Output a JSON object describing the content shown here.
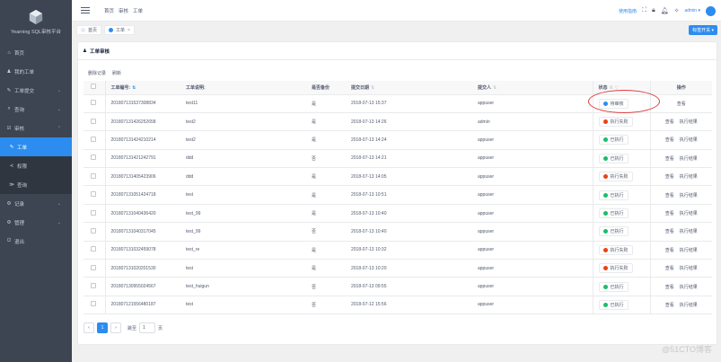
{
  "app": {
    "name": "Yearning SQL审核平台"
  },
  "sidebar": {
    "items": [
      {
        "icon": "home-icon",
        "glyph": "⌂",
        "label": "首页"
      },
      {
        "icon": "user-icon",
        "glyph": "♟",
        "label": "我的工单"
      },
      {
        "icon": "edit-icon",
        "glyph": "✎",
        "label": "工单提交",
        "chevron": "⌄"
      },
      {
        "icon": "search-icon",
        "glyph": "⌕",
        "label": "查询",
        "chevron": "⌄"
      },
      {
        "icon": "audit-icon",
        "glyph": "☑",
        "label": "审核",
        "chevron": "⌃"
      }
    ],
    "audit_sub": [
      {
        "icon": "pencil-icon",
        "glyph": "✎",
        "label": "工单",
        "active": true
      },
      {
        "icon": "share-icon",
        "glyph": "≺",
        "label": "权限"
      },
      {
        "icon": "query-icon",
        "glyph": "≫",
        "label": "查询"
      }
    ],
    "bottom": [
      {
        "icon": "record-icon",
        "glyph": "⚙",
        "label": "记录",
        "chevron": "⌄"
      },
      {
        "icon": "manage-icon",
        "glyph": "⚙",
        "label": "管理",
        "chevron": "⌄"
      },
      {
        "icon": "logout-icon",
        "glyph": "⏻",
        "label": "退出"
      }
    ]
  },
  "header": {
    "breadcrumb": [
      "首页",
      "审核",
      "工单"
    ],
    "help": "使用指南",
    "user": "admin ▾"
  },
  "tabs": {
    "items": [
      {
        "label": "首页",
        "closable": false
      },
      {
        "label": "工单",
        "closable": true,
        "x": "×"
      }
    ],
    "close_btn": "标签开关 ▾"
  },
  "card": {
    "title": "工单审核",
    "actions": [
      "删除记录",
      "刷新"
    ]
  },
  "table": {
    "headers": {
      "id": "工单编号:",
      "desc": "工单说明:",
      "backup": "是否备份",
      "time": "提交日期",
      "submitter": "提交人",
      "status": "状态",
      "op": "操作"
    },
    "sort_desc": "⇅",
    "sort_id": "⇅",
    "filter": "▽",
    "rows": [
      {
        "id": "201807131537308834",
        "desc": "test11",
        "backup": "是",
        "time": "2018-07-13 15:37",
        "submitter": "appuser",
        "status": "待审核",
        "status_color": "#2d8cf0",
        "ops": [
          "查看"
        ]
      },
      {
        "id": "201807131426252658",
        "desc": "test2",
        "backup": "是",
        "time": "2018-07-13 14:26",
        "submitter": "admin",
        "status": "执行失败",
        "status_color": "#ed4014",
        "ops": [
          "查看",
          "执行结果"
        ]
      },
      {
        "id": "201807131424210214",
        "desc": "test2",
        "backup": "是",
        "time": "2018-07-13 14:24",
        "submitter": "appuser",
        "status": "已执行",
        "status_color": "#19be6b",
        "ops": [
          "查看",
          "执行结果"
        ]
      },
      {
        "id": "201807131421242791",
        "desc": "ddd",
        "backup": "否",
        "time": "2018-07-13 14:21",
        "submitter": "appuser",
        "status": "已执行",
        "status_color": "#19be6b",
        "ops": [
          "查看",
          "执行结果"
        ]
      },
      {
        "id": "201807131405423906",
        "desc": "ddd",
        "backup": "是",
        "time": "2018-07-13 14:05",
        "submitter": "appuser",
        "status": "执行失败",
        "status_color": "#ed4014",
        "ops": [
          "查看",
          "执行结果"
        ]
      },
      {
        "id": "201807131051424718",
        "desc": "test",
        "backup": "是",
        "time": "2018-07-13 10:51",
        "submitter": "appuser",
        "status": "已执行",
        "status_color": "#19be6b",
        "ops": [
          "查看",
          "执行结果"
        ]
      },
      {
        "id": "201807131040436420",
        "desc": "test_99",
        "backup": "是",
        "time": "2018-07-13 10:40",
        "submitter": "appuser",
        "status": "已执行",
        "status_color": "#19be6b",
        "ops": [
          "查看",
          "执行结果"
        ]
      },
      {
        "id": "201807131040317045",
        "desc": "test_99",
        "backup": "否",
        "time": "2018-07-13 10:40",
        "submitter": "appuser",
        "status": "已执行",
        "status_color": "#19be6b",
        "ops": [
          "查看",
          "执行结果"
        ]
      },
      {
        "id": "201807131032459078",
        "desc": "test_re",
        "backup": "是",
        "time": "2018-07-13 10:32",
        "submitter": "appuser",
        "status": "执行失败",
        "status_color": "#ed4014",
        "ops": [
          "查看",
          "执行结果"
        ]
      },
      {
        "id": "201807131020201530",
        "desc": "test",
        "backup": "是",
        "time": "2018-07-13 10:20",
        "submitter": "appuser",
        "status": "执行失败",
        "status_color": "#ed4014",
        "ops": [
          "查看",
          "执行结果"
        ]
      },
      {
        "id": "201807130955024567",
        "desc": "test_huigun",
        "backup": "否",
        "time": "2018-07-13 09:55",
        "submitter": "appuser",
        "status": "已执行",
        "status_color": "#19be6b",
        "ops": [
          "查看",
          "执行结果"
        ]
      },
      {
        "id": "201807121556480187",
        "desc": "test",
        "backup": "否",
        "time": "2018-07-12 15:56",
        "submitter": "appuser",
        "status": "已执行",
        "status_color": "#19be6b",
        "ops": [
          "查看",
          "执行结果"
        ]
      }
    ]
  },
  "pager": {
    "prev": "‹",
    "page": "1",
    "next": "›",
    "goto_label": "跳至",
    "goto_value": "1",
    "unit": "页"
  },
  "watermark": "@51CTO博客"
}
